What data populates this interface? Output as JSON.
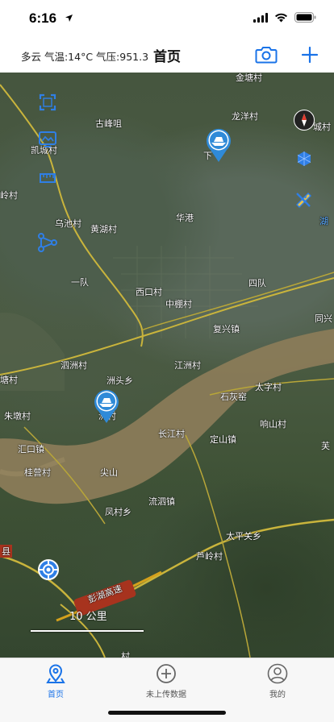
{
  "status_bar": {
    "time": "6:16",
    "icons": [
      "location-arrow-icon",
      "signal-icon",
      "wifi-icon",
      "battery-icon"
    ]
  },
  "nav": {
    "weather": "多云 气温:14°C 气压:951.3",
    "title": "首页",
    "camera_icon": "camera-icon",
    "add_icon": "plus-icon",
    "accent_color": "#1a73e8"
  },
  "map": {
    "places": [
      "金塘村",
      "古峰咀",
      "龙洋村",
      "下",
      "城村",
      "凯城村",
      "岭村",
      "乌池村",
      "黄湖村",
      "华港",
      "一队",
      "西口村",
      "中棚村",
      "四队",
      "复兴镇",
      "同兴",
      "泗洲村",
      "江洲村",
      "洲头乡",
      "塘村",
      "石灰窑",
      "太字村",
      "朱墩村",
      "洲村",
      "响山村",
      "长江村",
      "定山镇",
      "汇口镇",
      "桂营村",
      "尖山",
      "芙",
      "凤村乡",
      "流泗镇",
      "太平关乡",
      "芦岭村",
      "县",
      "村",
      "湖"
    ],
    "road_label": "彭湖高速",
    "scale_label": "10 公里",
    "tools": [
      "fullscreen-icon",
      "layers-icon",
      "ruler-icon",
      "measure-icon",
      "compass-icon",
      "area-icon",
      "pen-ruler-icon"
    ],
    "markers": [
      "boat-marker-icon",
      "boat-marker-icon"
    ],
    "location_icon": "current-location-icon"
  },
  "tabs": [
    {
      "label": "首页",
      "icon": "map-pin-icon",
      "active": true
    },
    {
      "label": "未上传数据",
      "icon": "add-circle-icon",
      "active": false
    },
    {
      "label": "我的",
      "icon": "user-icon",
      "active": false
    }
  ]
}
